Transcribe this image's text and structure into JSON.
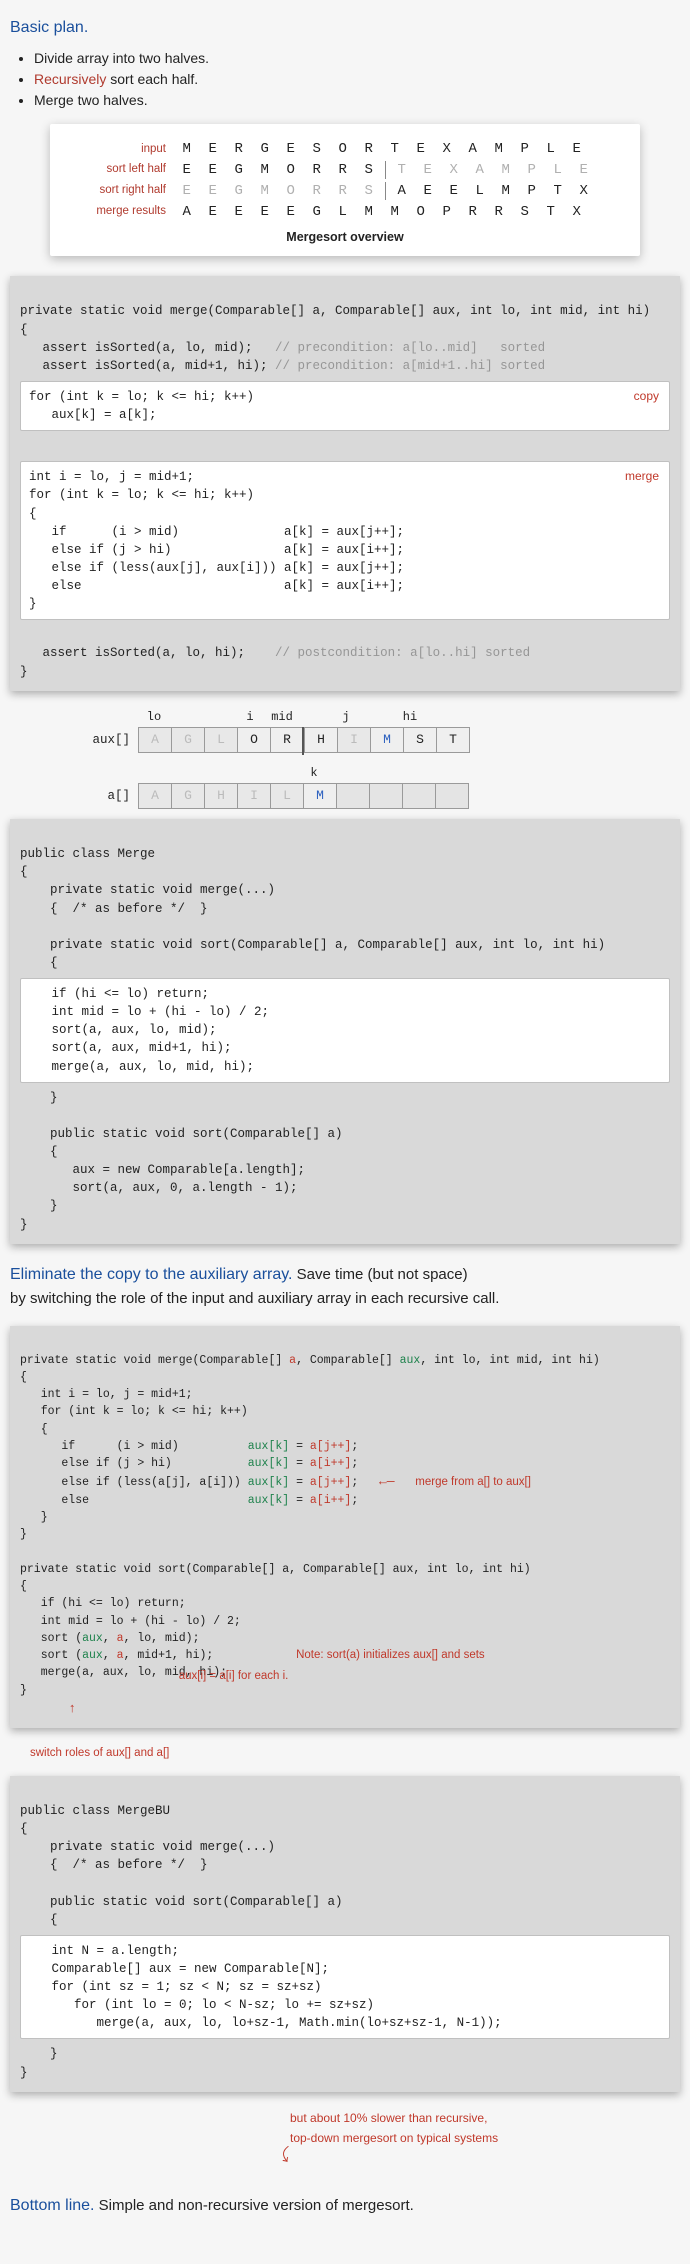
{
  "heading1": "Basic plan.",
  "plan_items": [
    "Divide array into two halves.",
    " sort each half.",
    "Merge two halves."
  ],
  "plan_recursively_prefix": "Recursively",
  "overview": {
    "row_labels": [
      "input",
      "sort left half",
      "sort right half",
      "merge results"
    ],
    "rows": [
      [
        "M",
        "E",
        "R",
        "G",
        "E",
        "S",
        "O",
        "R",
        "T",
        "E",
        "X",
        "A",
        "M",
        "P",
        "L",
        "E"
      ],
      [
        "E",
        "E",
        "G",
        "M",
        "O",
        "R",
        "R",
        "S",
        "T",
        "E",
        "X",
        "A",
        "M",
        "P",
        "L",
        "E"
      ],
      [
        "E",
        "E",
        "G",
        "M",
        "O",
        "R",
        "R",
        "S",
        "A",
        "E",
        "E",
        "L",
        "M",
        "P",
        "T",
        "X"
      ],
      [
        "A",
        "E",
        "E",
        "E",
        "E",
        "G",
        "L",
        "M",
        "M",
        "O",
        "P",
        "R",
        "R",
        "S",
        "T",
        "X"
      ]
    ],
    "caption": "Mergesort overview"
  },
  "code1": {
    "sig": "private static void merge(Comparable[] a, Comparable[] aux, int lo, int mid, int hi)\n{",
    "assert1": "   assert isSorted(a, lo, mid);   ",
    "assert1_comment": "// precondition: a[lo..mid]   sorted",
    "assert2": "   assert isSorted(a, mid+1, hi); ",
    "assert2_comment": "// precondition: a[mid+1..hi] sorted",
    "copy_box": "for (int k = lo; k <= hi; k++)\n   aux[k] = a[k];",
    "copy_label": "copy",
    "merge_box": "int i = lo, j = mid+1;\nfor (int k = lo; k <= hi; k++)\n{\n   if      (i > mid)              a[k] = aux[j++];\n   else if (j > hi)               a[k] = aux[i++];\n   else if (less(aux[j], aux[i])) a[k] = aux[j++];\n   else                           a[k] = aux[i++];\n}",
    "merge_label": "merge",
    "post_assert": "   assert isSorted(a, lo, hi);    ",
    "post_comment": "// postcondition: a[lo..hi] sorted",
    "close": "}"
  },
  "diagram": {
    "top_labels": [
      "lo",
      "",
      "",
      "i",
      "mid",
      "",
      "j",
      "",
      "hi"
    ],
    "aux_label": "aux[]",
    "aux": [
      "A",
      "G",
      "L",
      "O",
      "R",
      "H",
      "I",
      "M",
      "S",
      "T"
    ],
    "k_label": "k",
    "a_label": "a[]",
    "a": [
      "A",
      "G",
      "H",
      "I",
      "L",
      "M",
      "",
      "",
      "",
      ""
    ]
  },
  "code2": {
    "lines": "public class Merge\n{\n    private static void merge(...)\n    {  /* as before */  }\n\n    private static void sort(Comparable[] a, Comparable[] aux, int lo, int hi)\n    {",
    "sort_box": "   if (hi <= lo) return;\n   int mid = lo + (hi - lo) / 2;\n   sort(a, aux, lo, mid);\n   sort(a, aux, mid+1, hi);\n   merge(a, aux, lo, mid, hi);",
    "after_box": "    }\n\n    public static void sort(Comparable[] a)\n    {\n       aux = new Comparable[a.length];\n       sort(a, aux, 0, a.length - 1);\n    }\n}"
  },
  "para_eliminate_lead": "Eliminate the copy to the auxiliary array.",
  "para_eliminate_rest": "  Save time (but not space)",
  "para_eliminate_line2": "by switching the role of the input and auxiliary array in each recursive call.",
  "code3": {
    "merge_sig_pre": "private static void merge(Comparable[] ",
    "merge_sig_a": "a",
    "merge_sig_mid1": ", Comparable[] ",
    "merge_sig_aux": "aux",
    "merge_sig_post": ", int lo, int mid, int hi)\n{\n   int i = lo, j = mid+1;\n   for (int k = lo; k <= hi; k++)\n   {\n      if      (i > mid)          ",
    "assign1_lhs": "aux[k]",
    "assign1_eq": " = ",
    "assign1_rhs": "a[j++]",
    "assign1_end": ";\n      else if (j > hi)           ",
    "assign2_lhs": "aux[k]",
    "assign2_rhs": "a[i++]",
    "assign2_end": ";\n      else if (less(a[j], a[i])) ",
    "assign3_lhs": "aux[k]",
    "assign3_rhs": "a[j++]",
    "assign3_end": ";",
    "arrow_merge_label": "merge from a[] to aux[]",
    "line_else": "\n      else                       ",
    "assign4_lhs": "aux[k]",
    "assign4_rhs": "a[i++]",
    "assign4_end": ";\n   }\n}\n\nprivate static void sort(Comparable[] a, Comparable[] aux, int lo, int hi)\n{\n   if (hi <= lo) return;\n   int mid = lo + (hi - lo) / 2;\n   sort (",
    "sort_aux1": "aux",
    "sort_mid1": ", ",
    "sort_a1": "a",
    "sort_end1": ", lo, mid);\n   sort (",
    "sort_aux2": "aux",
    "sort_a2": "a",
    "sort_end2": ", mid+1, hi);",
    "note_label1": "Note: sort(a) initializes aux[] and sets",
    "note_label2": "aux[i] = a[i] for each i.",
    "merge_call": "\n   merge(a, aux, lo, mid, hi);\n}",
    "switch_label": "switch roles of aux[] and a[]"
  },
  "code4": {
    "pre": "public class MergeBU\n{\n    private static void merge(...)\n    {  /* as before */  }\n\n    public static void sort(Comparable[] a)\n    {",
    "box": "   int N = a.length;\n   Comparable[] aux = new Comparable[N];\n   for (int sz = 1; sz < N; sz = sz+sz)\n      for (int lo = 0; lo < N-sz; lo += sz+sz)\n         merge(a, aux, lo, lo+sz-1, Math.min(lo+sz+sz-1, N-1));",
    "post": "    }\n}"
  },
  "bottom_note1": "but about 10% slower than recursive,",
  "bottom_note2": "top-down mergesort on typical systems",
  "bottomline_lead": "Bottom line.",
  "bottomline_rest": "  Simple and non-recursive version of mergesort."
}
